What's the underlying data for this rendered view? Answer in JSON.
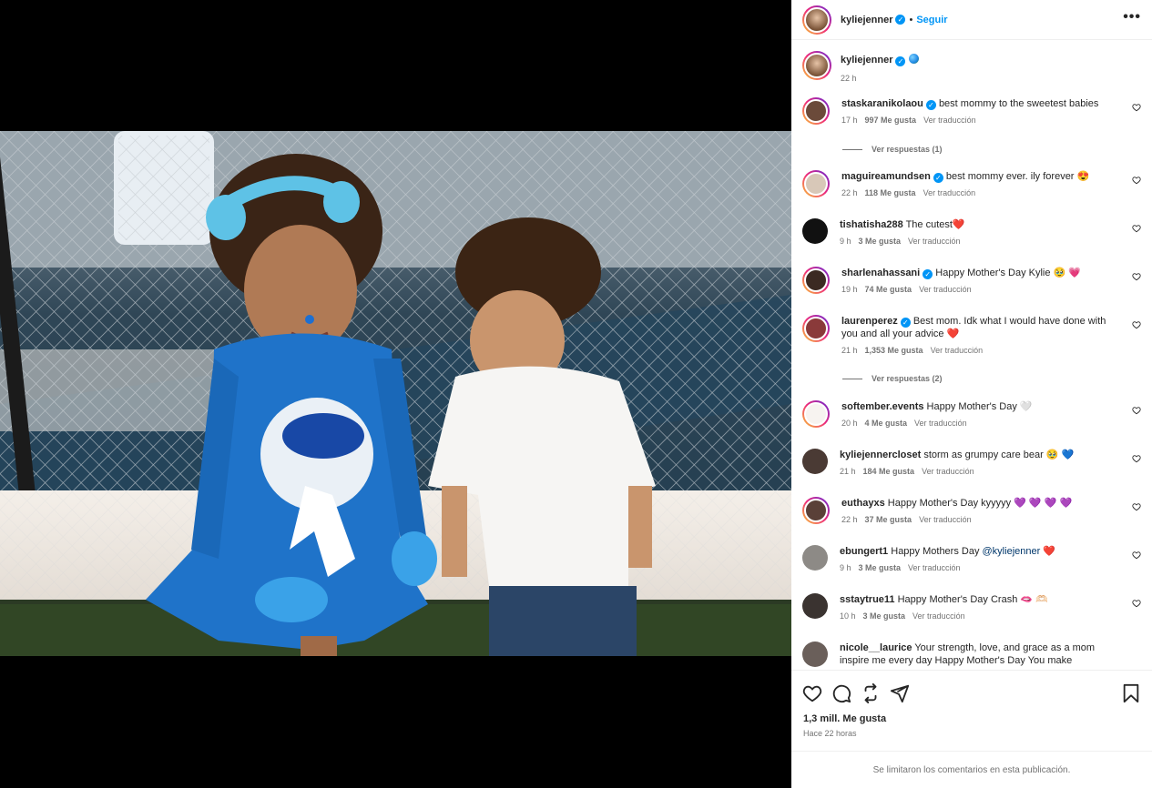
{
  "post": {
    "author": "kyliejenner",
    "follow_label": "Seguir",
    "separator": "•",
    "more_label": "•••",
    "caption_time": "22 h"
  },
  "comments": [
    {
      "user": "staskaranikolaou",
      "verified": true,
      "text": "best mommy to the sweetest babies",
      "time": "17 h",
      "likes": "997 Me gusta",
      "translate": "Ver traducción",
      "replies": "Ver respuestas (1)"
    },
    {
      "user": "maguireamundsen",
      "verified": true,
      "text": "best mommy ever. ily forever 😍",
      "time": "22 h",
      "likes": "118 Me gusta",
      "translate": "Ver traducción"
    },
    {
      "user": "tishatisha288",
      "verified": false,
      "text": "The cutest❤️",
      "time": "9 h",
      "likes": "3 Me gusta",
      "translate": "Ver traducción"
    },
    {
      "user": "sharlenahassani",
      "verified": true,
      "text": "Happy Mother's Day Kylie 🥹 💗",
      "time": "19 h",
      "likes": "74 Me gusta",
      "translate": "Ver traducción"
    },
    {
      "user": "laurenperez",
      "verified": true,
      "text": "Best mom. Idk what I would have done with you and all your advice ❤️",
      "time": "21 h",
      "likes": "1,353 Me gusta",
      "translate": "Ver traducción",
      "replies": "Ver respuestas (2)"
    },
    {
      "user": "softember.events",
      "verified": false,
      "text": "Happy Mother's Day 🤍",
      "time": "20 h",
      "likes": "4 Me gusta",
      "translate": "Ver traducción"
    },
    {
      "user": "kyliejennercloset",
      "verified": false,
      "text": "storm as grumpy care bear 🥹 💙",
      "time": "21 h",
      "likes": "184 Me gusta",
      "translate": "Ver traducción"
    },
    {
      "user": "euthayxs",
      "verified": false,
      "text": "Happy Mother's Day kyyyyy 💜 💜 💜 💜",
      "time": "22 h",
      "likes": "37 Me gusta",
      "translate": "Ver traducción"
    },
    {
      "user": "ebungert1",
      "verified": false,
      "text": "Happy Mothers Day ",
      "mention": "@kyliejenner",
      "text_after": " ❤️",
      "time": "9 h",
      "likes": "3 Me gusta",
      "translate": "Ver traducción"
    },
    {
      "user": "sstaytrue11",
      "verified": false,
      "text": "Happy Mother's Day Crash 🫦 🫶🏻",
      "time": "10 h",
      "likes": "3 Me gusta",
      "translate": "Ver traducción"
    },
    {
      "user": "nicole__laurice",
      "verified": false,
      "text": "Your strength, love, and grace as a mom inspire me every day Happy Mother's Day You make motherhood look"
    }
  ],
  "footer": {
    "likes": "1,3 mill. Me gusta",
    "ago": "Hace 22 horas",
    "limited": "Se limitaron los comentarios en esta publicación."
  },
  "colors": {
    "accent": "#0095f6",
    "muted": "#737373",
    "text": "#262626"
  }
}
